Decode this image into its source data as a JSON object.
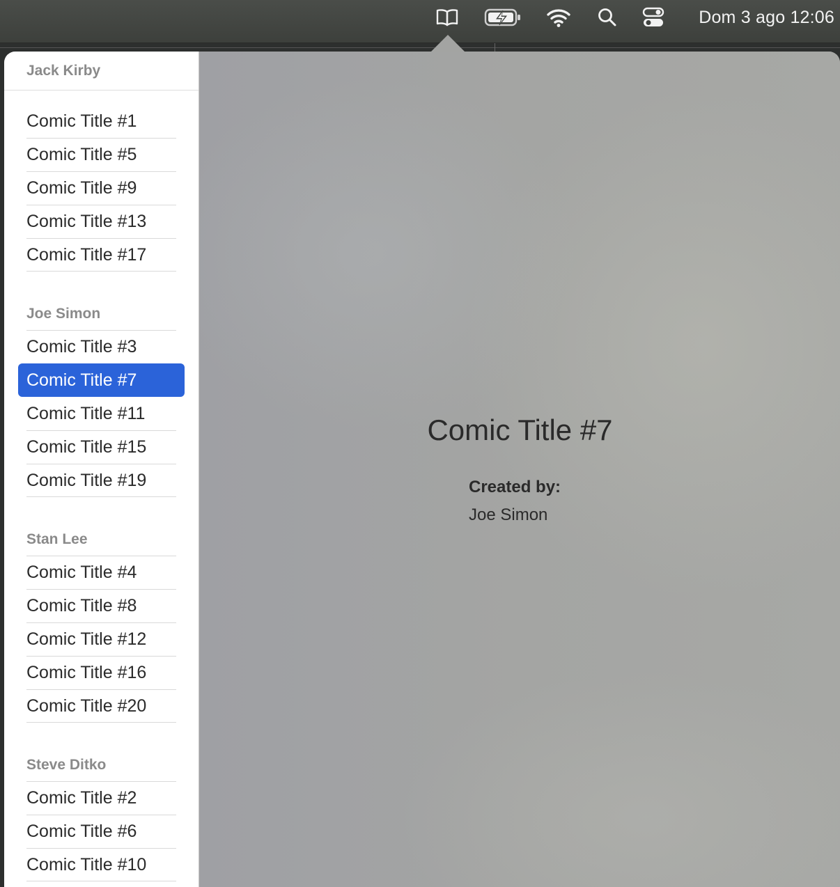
{
  "menubar": {
    "icons": [
      "book-icon",
      "battery-charging-icon",
      "wifi-icon",
      "search-icon",
      "control-center-icon"
    ],
    "clock": "Dom 3 ago 12:06"
  },
  "sidebar": {
    "sections": [
      {
        "header": "Jack Kirby",
        "items": [
          "Comic Title #1",
          "Comic Title #5",
          "Comic Title #9",
          "Comic Title #13",
          "Comic Title #17"
        ]
      },
      {
        "header": "Joe Simon",
        "items": [
          "Comic Title #3",
          "Comic Title #7",
          "Comic Title #11",
          "Comic Title #15",
          "Comic Title #19"
        ]
      },
      {
        "header": "Stan Lee",
        "items": [
          "Comic Title #4",
          "Comic Title #8",
          "Comic Title #12",
          "Comic Title #16",
          "Comic Title #20"
        ]
      },
      {
        "header": "Steve Ditko",
        "items": [
          "Comic Title #2",
          "Comic Title #6",
          "Comic Title #10"
        ]
      }
    ],
    "selected": "Comic Title #7"
  },
  "detail": {
    "title": "Comic Title #7",
    "created_by_label": "Created by:",
    "created_by_value": "Joe Simon"
  },
  "colors": {
    "selection": "#2b63d9",
    "menubar": "#444744"
  }
}
